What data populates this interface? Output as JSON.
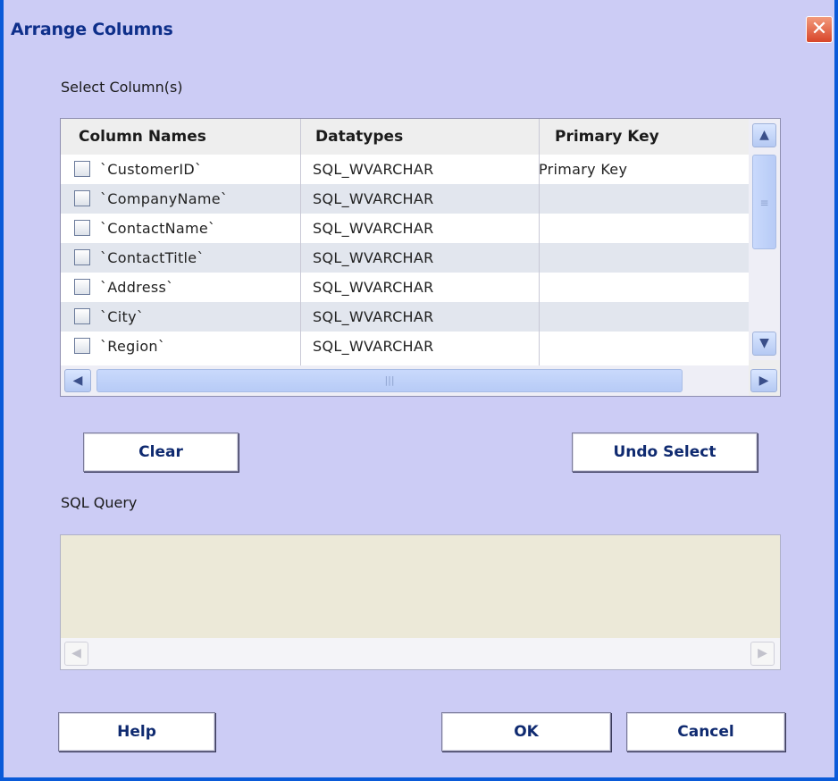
{
  "window": {
    "title": "Arrange Columns",
    "close_icon": "close-icon"
  },
  "select_section": {
    "label": "Select Column(s)"
  },
  "grid": {
    "headers": [
      "Column Names",
      "Datatypes",
      "Primary Key"
    ],
    "rows": [
      {
        "name": "`CustomerID`",
        "datatype": "SQL_WVARCHAR",
        "primary_key": "Primary Key",
        "checked": false
      },
      {
        "name": "`CompanyName`",
        "datatype": "SQL_WVARCHAR",
        "primary_key": "",
        "checked": false
      },
      {
        "name": "`ContactName`",
        "datatype": "SQL_WVARCHAR",
        "primary_key": "",
        "checked": false
      },
      {
        "name": "`ContactTitle`",
        "datatype": "SQL_WVARCHAR",
        "primary_key": "",
        "checked": false
      },
      {
        "name": "`Address`",
        "datatype": "SQL_WVARCHAR",
        "primary_key": "",
        "checked": false
      },
      {
        "name": "`City`",
        "datatype": "SQL_WVARCHAR",
        "primary_key": "",
        "checked": false
      },
      {
        "name": "`Region`",
        "datatype": "SQL_WVARCHAR",
        "primary_key": "",
        "checked": false
      }
    ]
  },
  "buttons": {
    "clear": "Clear",
    "undo_select": "Undo Select",
    "help": "Help",
    "ok": "OK",
    "cancel": "Cancel"
  },
  "sql_section": {
    "label": "SQL Query",
    "value": ""
  },
  "icons": {
    "scroll_up": "▲",
    "scroll_down": "▼",
    "scroll_left": "◀",
    "scroll_right": "▶",
    "close": "✕"
  },
  "colors": {
    "background": "#ccccf5",
    "title": "#0e2f8a",
    "button_text": "#0f2a70"
  }
}
